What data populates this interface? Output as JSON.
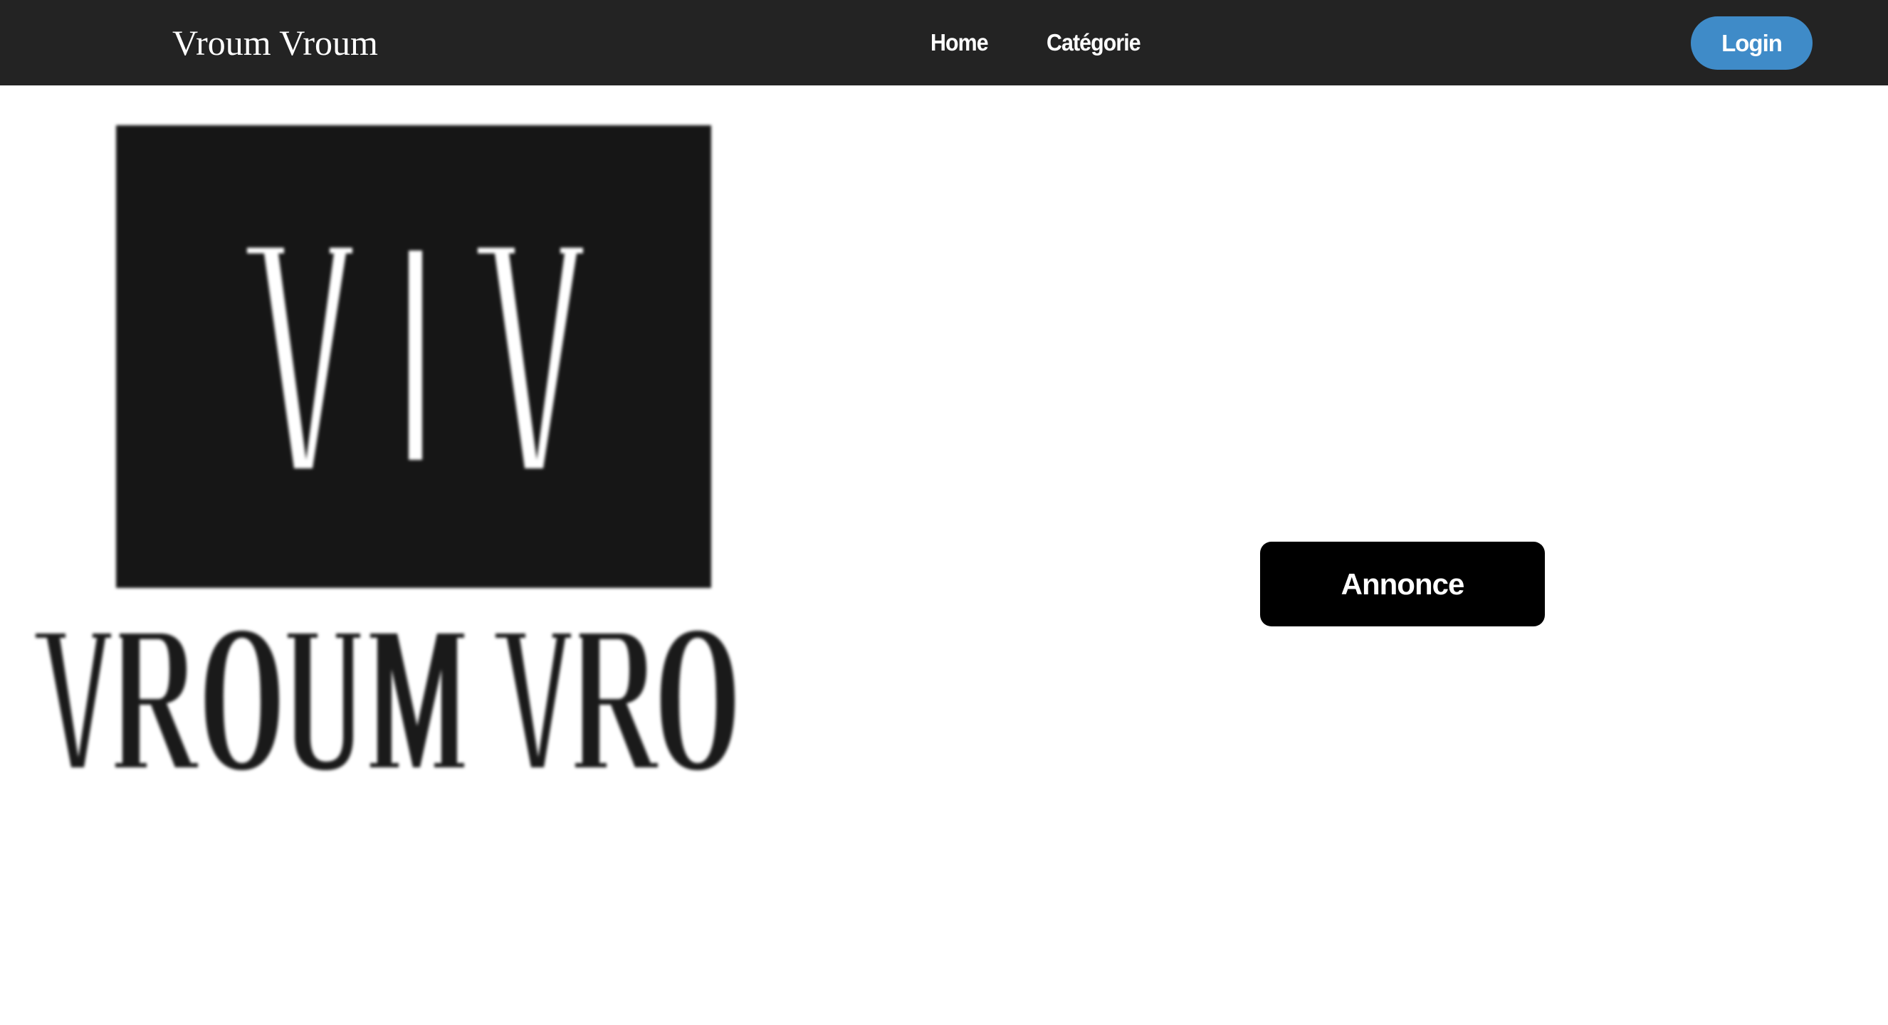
{
  "navbar": {
    "brand": "Vroum Vroum",
    "links": [
      {
        "label": "Home"
      },
      {
        "label": "Catégorie"
      }
    ],
    "login_label": "Login"
  },
  "hero": {
    "logo_monogram": "V|V",
    "logo_wordmark": "VROUM VROUM",
    "annonce_label": "Annonce"
  },
  "colors": {
    "navbar_bg": "#232323",
    "login_bg": "#3f8bc8",
    "annonce_bg": "#000000",
    "logo_box": "#161616"
  }
}
